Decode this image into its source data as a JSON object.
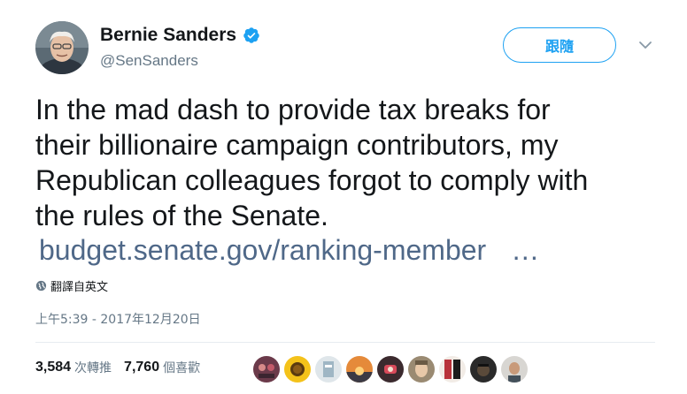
{
  "author": {
    "name": "Bernie Sanders",
    "handle": "@SenSanders",
    "verified_icon": "verified-badge-icon"
  },
  "follow_button": {
    "label": "跟隨"
  },
  "tweet": {
    "lines": [
      "In the mad dash to provide tax breaks for",
      "their billionaire campaign contributors, my",
      "Republican colleagues forgot to comply with",
      "the rules of the Senate."
    ],
    "link": "budget.senate.gov/ranking-member",
    "ellipsis": "…",
    "translate_label": "翻譯自英文",
    "timestamp": "上午5:39 - 2017年12月20日"
  },
  "stats": {
    "retweets_count": "3,584",
    "retweets_label": "次轉推",
    "likes_count": "7,760",
    "likes_label": "個喜歡"
  },
  "colors": {
    "accent": "#1da1f2",
    "link": "#4f6888",
    "secondary_text": "#657786",
    "divider": "#e6ecf0"
  }
}
